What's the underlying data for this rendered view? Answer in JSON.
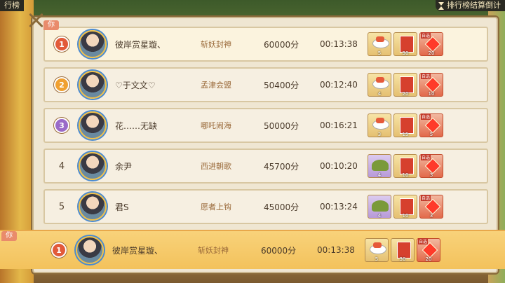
{
  "header": {
    "title": "行榜",
    "countdown_label": "排行榜结算倒计"
  },
  "you_label": "你",
  "rows": [
    {
      "rank": "1",
      "name": "彼岸赏星璇、",
      "title": "斩妖封神",
      "score": "60000分",
      "time": "00:13:38",
      "medal_color": "#e25a3a",
      "rewards": [
        {
          "icon": "dish-icon",
          "tone": "gold",
          "count": "5"
        },
        {
          "icon": "book-icon",
          "tone": "gold",
          "count": "30"
        },
        {
          "icon": "diamond-icon",
          "tone": "red",
          "count": "20",
          "pick": "自选"
        }
      ]
    },
    {
      "rank": "2",
      "name": "♡于文文♡",
      "title": "孟津会盟",
      "score": "50400分",
      "time": "00:12:40",
      "medal_color": "#f0a030",
      "rewards": [
        {
          "icon": "dish-icon",
          "tone": "gold",
          "count": "4"
        },
        {
          "icon": "book-icon",
          "tone": "gold",
          "count": "20"
        },
        {
          "icon": "diamond-icon",
          "tone": "red",
          "count": "10",
          "pick": "自选"
        }
      ]
    },
    {
      "rank": "3",
      "name": "花……无缺",
      "title": "哪吒闹海",
      "score": "50000分",
      "time": "00:16:21",
      "medal_color": "#9a6ac8",
      "rewards": [
        {
          "icon": "dish-icon",
          "tone": "gold",
          "count": "3"
        },
        {
          "icon": "book-icon",
          "tone": "gold",
          "count": "15"
        },
        {
          "icon": "diamond-icon",
          "tone": "red",
          "count": "5",
          "pick": "自选"
        }
      ]
    },
    {
      "rank": "4",
      "name": "余尹",
      "title": "西进朝歌",
      "score": "45700分",
      "time": "00:10:20",
      "medal_color": "",
      "rewards": [
        {
          "icon": "dumpling-icon",
          "tone": "purple",
          "count": "4"
        },
        {
          "icon": "book-icon",
          "tone": "gold",
          "count": "10"
        },
        {
          "icon": "diamond-icon",
          "tone": "red",
          "count": "3",
          "pick": "自选"
        }
      ]
    },
    {
      "rank": "5",
      "name": "君S",
      "title": "愿者上钩",
      "score": "45000分",
      "time": "00:13:24",
      "medal_color": "",
      "rewards": [
        {
          "icon": "dumpling-icon",
          "tone": "purple",
          "count": "4"
        },
        {
          "icon": "book-icon",
          "tone": "gold",
          "count": "10"
        },
        {
          "icon": "diamond-icon",
          "tone": "red",
          "count": "3",
          "pick": "自选"
        }
      ]
    }
  ],
  "me": {
    "rank": "1",
    "name": "彼岸赏星璇、",
    "title": "斩妖封神",
    "score": "60000分",
    "time": "00:13:38",
    "medal_color": "#e25a3a",
    "rewards": [
      {
        "icon": "dish-icon",
        "tone": "gold",
        "count": "5"
      },
      {
        "icon": "book-icon",
        "tone": "gold",
        "count": "30"
      },
      {
        "icon": "diamond-icon",
        "tone": "red",
        "count": "20",
        "pick": "自选"
      }
    ]
  }
}
